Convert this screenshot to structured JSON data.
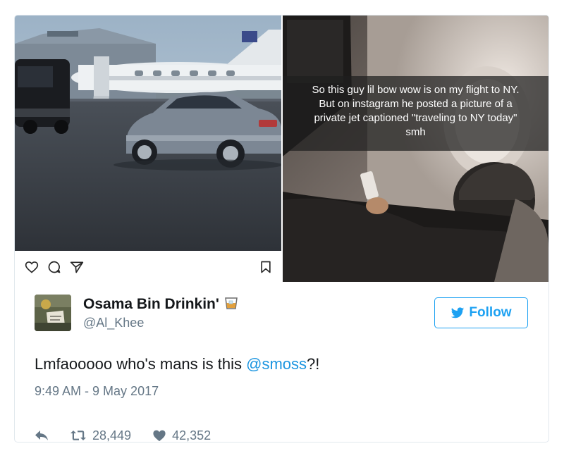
{
  "snapchat": {
    "caption": "So this guy lil bow wow is on my flight to NY.\nBut on instagram he posted a picture of a\nprivate jet captioned \"traveling to NY today\"\nsmh"
  },
  "tweet": {
    "display_name": "Osama Bin Drinkin'",
    "handle": "@Al_Khee",
    "follow_label": "Follow",
    "text_before": "Lmfaooooo who's mans is this ",
    "mention": "@smoss",
    "text_after": "?!",
    "timestamp": "9:49 AM - 9 May 2017",
    "retweets": "28,449",
    "likes": "42,352"
  },
  "icons": {
    "name_emoji": "tumbler-glass-icon",
    "follow": "bird-icon",
    "reply": "reply-icon",
    "retweet": "retweet-icon",
    "like": "heart-icon",
    "ig_like": "heart-outline-icon",
    "ig_comment": "comment-icon",
    "ig_share": "paper-plane-icon",
    "ig_save": "bookmark-icon"
  },
  "colors": {
    "accent": "#1da1f2",
    "mention": "#1b95e0",
    "muted": "#657786",
    "text": "#14171a"
  }
}
